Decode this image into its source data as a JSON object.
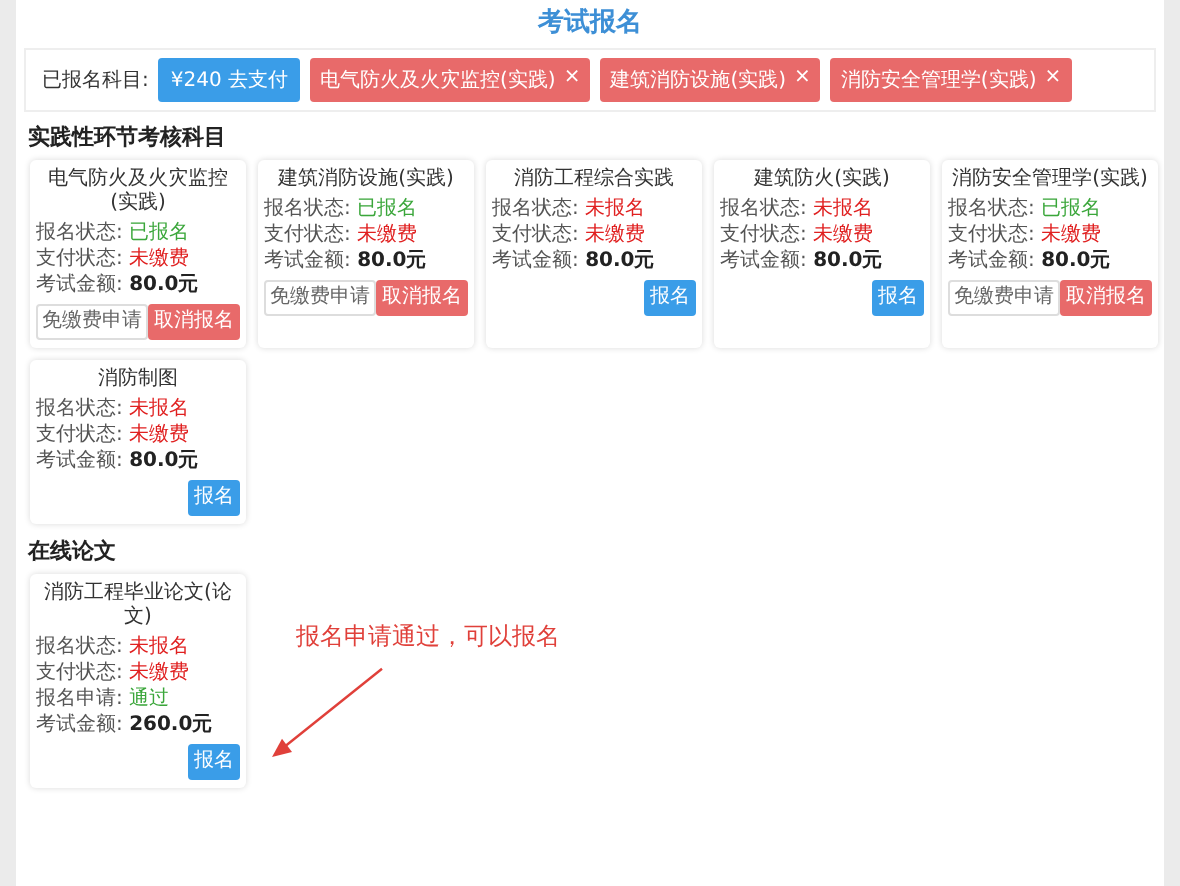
{
  "page_title": "考试报名",
  "registered": {
    "label": "已报名科目:",
    "pay_button": "¥240 去支付",
    "tags": [
      {
        "label": "电气防火及火灾监控(实践)",
        "close": "×"
      },
      {
        "label": "建筑消防设施(实践)",
        "close": "×"
      },
      {
        "label": "消防安全管理学(实践)",
        "close": "×"
      }
    ]
  },
  "sections": [
    {
      "title": "实践性环节考核科目",
      "cards": [
        {
          "title": "电气防火及火灾监控(实践)",
          "fields": [
            {
              "label": "报名状态:",
              "value": "已报名",
              "kind": "positive"
            },
            {
              "label": "支付状态:",
              "value": "未缴费",
              "kind": "negative"
            },
            {
              "label": "考试金额:",
              "value": "80.0元",
              "kind": "amount"
            }
          ],
          "buttons": [
            {
              "label": "免缴费申请",
              "kind": "plain"
            },
            {
              "label": "取消报名",
              "kind": "danger"
            }
          ]
        },
        {
          "title": "建筑消防设施(实践)",
          "fields": [
            {
              "label": "报名状态:",
              "value": "已报名",
              "kind": "positive"
            },
            {
              "label": "支付状态:",
              "value": "未缴费",
              "kind": "negative"
            },
            {
              "label": "考试金额:",
              "value": "80.0元",
              "kind": "amount"
            }
          ],
          "buttons": [
            {
              "label": "免缴费申请",
              "kind": "plain"
            },
            {
              "label": "取消报名",
              "kind": "danger"
            }
          ]
        },
        {
          "title": "消防工程综合实践",
          "fields": [
            {
              "label": "报名状态:",
              "value": "未报名",
              "kind": "negative"
            },
            {
              "label": "支付状态:",
              "value": "未缴费",
              "kind": "negative"
            },
            {
              "label": "考试金额:",
              "value": "80.0元",
              "kind": "amount"
            }
          ],
          "buttons": [
            {
              "label": "报名",
              "kind": "primary"
            }
          ]
        },
        {
          "title": "建筑防火(实践)",
          "fields": [
            {
              "label": "报名状态:",
              "value": "未报名",
              "kind": "negative"
            },
            {
              "label": "支付状态:",
              "value": "未缴费",
              "kind": "negative"
            },
            {
              "label": "考试金额:",
              "value": "80.0元",
              "kind": "amount"
            }
          ],
          "buttons": [
            {
              "label": "报名",
              "kind": "primary"
            }
          ]
        },
        {
          "title": "消防安全管理学(实践)",
          "fields": [
            {
              "label": "报名状态:",
              "value": "已报名",
              "kind": "positive"
            },
            {
              "label": "支付状态:",
              "value": "未缴费",
              "kind": "negative"
            },
            {
              "label": "考试金额:",
              "value": "80.0元",
              "kind": "amount"
            }
          ],
          "buttons": [
            {
              "label": "免缴费申请",
              "kind": "plain"
            },
            {
              "label": "取消报名",
              "kind": "danger"
            }
          ]
        },
        {
          "title": "消防制图",
          "fields": [
            {
              "label": "报名状态:",
              "value": "未报名",
              "kind": "negative"
            },
            {
              "label": "支付状态:",
              "value": "未缴费",
              "kind": "negative"
            },
            {
              "label": "考试金额:",
              "value": "80.0元",
              "kind": "amount"
            }
          ],
          "buttons": [
            {
              "label": "报名",
              "kind": "primary"
            }
          ]
        }
      ]
    },
    {
      "title": "在线论文",
      "annotation": "报名申请通过，可以报名",
      "cards": [
        {
          "title": "消防工程毕业论文(论文)",
          "fields": [
            {
              "label": "报名状态:",
              "value": "未报名",
              "kind": "negative"
            },
            {
              "label": "支付状态:",
              "value": "未缴费",
              "kind": "negative"
            },
            {
              "label": "报名申请:",
              "value": "通过",
              "kind": "positive"
            },
            {
              "label": "考试金额:",
              "value": "260.0元",
              "kind": "amount"
            }
          ],
          "buttons": [
            {
              "label": "报名",
              "kind": "primary"
            }
          ]
        }
      ]
    }
  ]
}
